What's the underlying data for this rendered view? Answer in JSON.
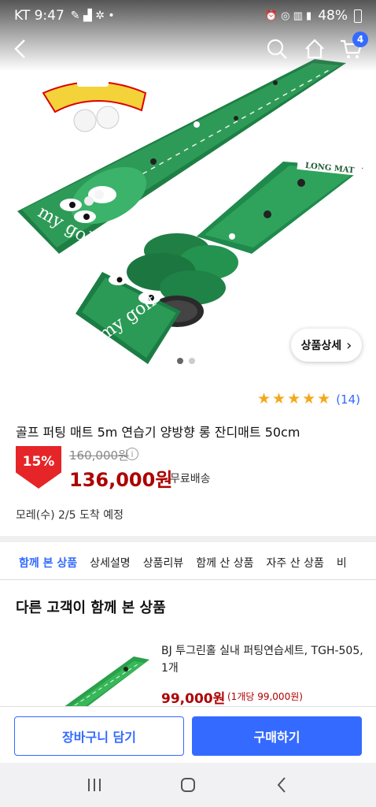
{
  "status_bar": {
    "carrier_time": "KT 9:47",
    "battery": "48%"
  },
  "nav": {
    "cart_count": "4"
  },
  "hero": {
    "detail_chip_label": "상품상세",
    "mat_label": "LONG MAT",
    "brand_script": "my golf"
  },
  "product": {
    "rating_stars": 5,
    "review_count": "(14)",
    "title": "골프 퍼팅 매트 5m 연습기 양방향 롱 잔디매트 50cm",
    "discount": "15%",
    "original_price": "160,000원",
    "sale_price": "136,000원",
    "shipping": "무료배송",
    "delivery": "모레(수) 2/5 도착 예정"
  },
  "tabs": [
    {
      "label": "함께 본 상품",
      "active": true
    },
    {
      "label": "상세설명",
      "active": false
    },
    {
      "label": "상품리뷰",
      "active": false
    },
    {
      "label": "함께 산 상품",
      "active": false
    },
    {
      "label": "자주 산 상품",
      "active": false
    },
    {
      "label": "비",
      "active": false
    }
  ],
  "recommend": {
    "section_title": "다른 고객이 함께 본 상품",
    "item_name": "BJ 투그린홀 실내 퍼팅연습세트, TGH-505, 1개",
    "item_price": "99,000원",
    "item_unit_price": "(1개당 99,000원)"
  },
  "bottom": {
    "cart_button": "장바구니 담기",
    "buy_button": "구매하기"
  },
  "colors": {
    "accent": "#346aff",
    "price_red": "#ae0000",
    "discount_red": "#e52528",
    "star": "#f4a81d",
    "mat_green": "#1f8a4c"
  }
}
